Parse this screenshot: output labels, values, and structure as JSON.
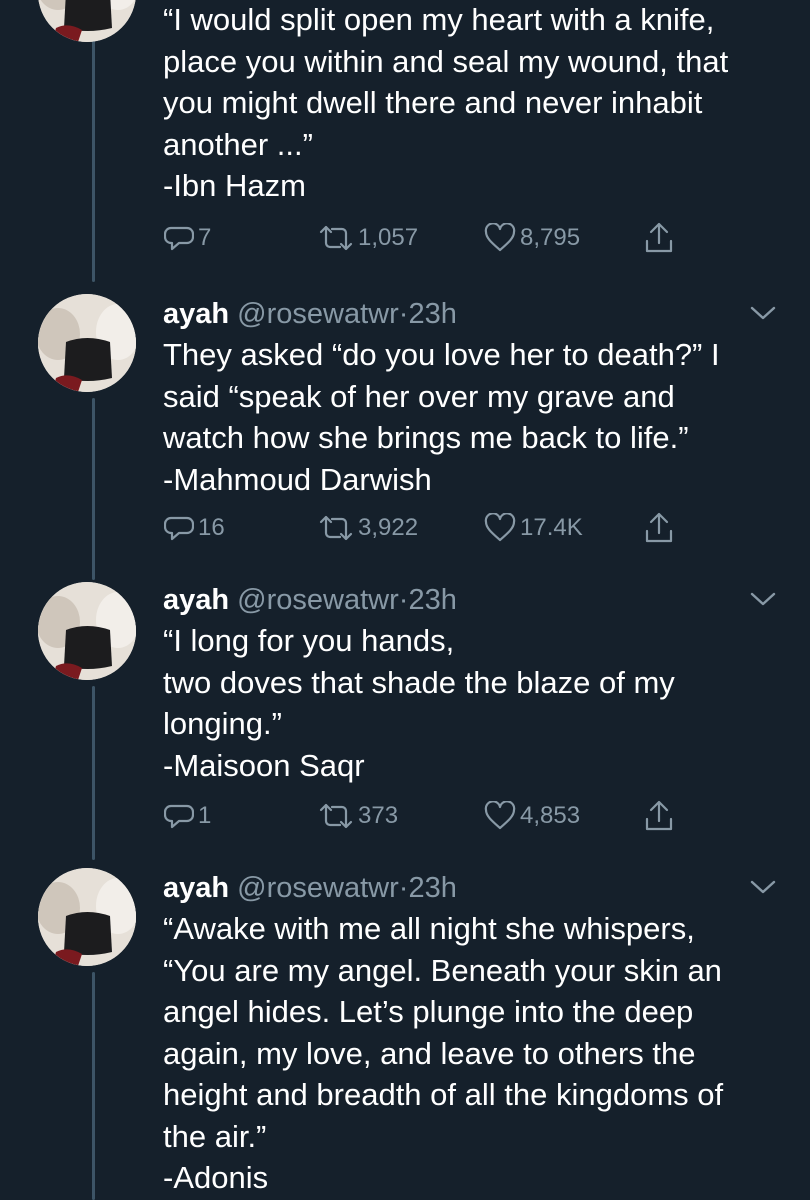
{
  "tweets": [
    {
      "author_name": "",
      "author_handle": "",
      "time": "",
      "text_lines": [
        "“I would split open my heart with a knife,",
        "place you within and seal my wound, that",
        "you might dwell there and never inhabit",
        "another ...”",
        "-Ibn Hazm"
      ],
      "replies": "7",
      "retweets": "1,057",
      "likes": "8,795"
    },
    {
      "author_name": "ayah",
      "author_handle": "@rosewatwr",
      "time": "23h",
      "text_lines": [
        "They asked “do you love her to death?” I",
        "said “speak of her over my grave and",
        "watch how she brings me back to life.”",
        "-Mahmoud Darwish"
      ],
      "replies": "16",
      "retweets": "3,922",
      "likes": "17.4K"
    },
    {
      "author_name": "ayah",
      "author_handle": "@rosewatwr",
      "time": "23h",
      "text_lines": [
        "“I long for you hands,",
        "two doves that shade the blaze of my",
        "longing.”",
        "-Maisoon Saqr"
      ],
      "replies": "1",
      "retweets": "373",
      "likes": "4,853"
    },
    {
      "author_name": "ayah",
      "author_handle": "@rosewatwr",
      "time": "23h",
      "text_lines": [
        "“Awake with me all night she whispers,",
        "“You are my angel. Beneath your skin an",
        "angel hides. Let’s plunge into the deep",
        "again, my love, and leave to others the",
        "height and breadth of all the kingdoms of",
        "the air.”",
        "-Adonis"
      ]
    }
  ],
  "separator": "·",
  "icons": {
    "reply": "reply-icon",
    "retweet": "retweet-icon",
    "like": "heart-icon",
    "share": "share-icon",
    "menu": "chevron-down-icon"
  },
  "colors": {
    "background": "#15202b",
    "text": "#ffffff",
    "secondary": "#8899a6",
    "thread_line": "#3d5466"
  }
}
